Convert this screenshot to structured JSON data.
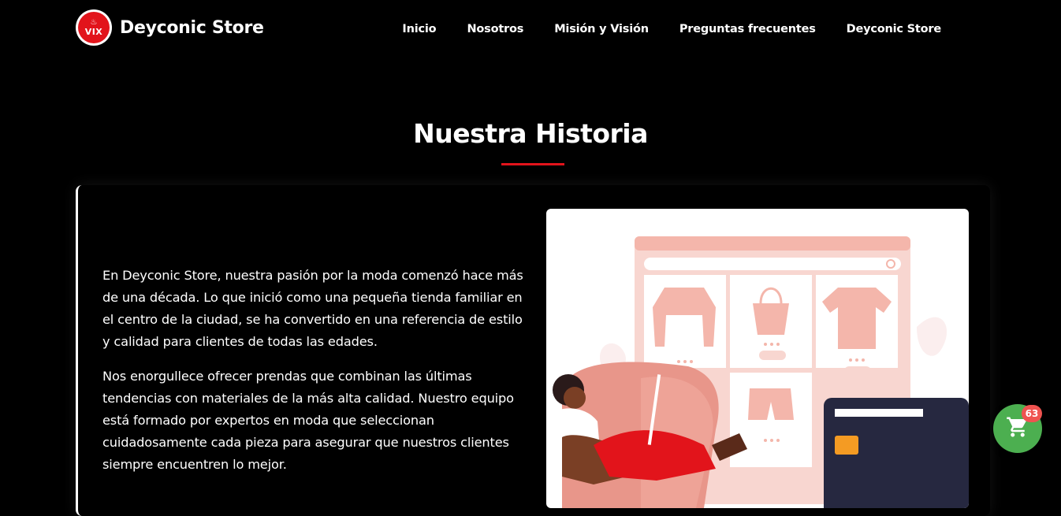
{
  "brand": {
    "name": "Deyconic Store",
    "logo_text": "VIX"
  },
  "nav": {
    "items": [
      {
        "label": "Inicio"
      },
      {
        "label": "Nosotros"
      },
      {
        "label": "Misión y Visión"
      },
      {
        "label": "Preguntas frecuentes"
      },
      {
        "label": "Deyconic Store"
      }
    ]
  },
  "history": {
    "title": "Nuestra Historia",
    "paragraphs": [
      "En Deyconic Store, nuestra pasión por la moda comenzó hace más de una década. Lo que inició como una pequeña tienda familiar en el centro de la ciudad, se ha convertido en una referencia de estilo y calidad para clientes de todas las edades.",
      "Nos enorgullece ofrecer prendas que combinan las últimas tendencias con materiales de la más alta calidad. Nuestro equipo está formado por expertos en moda que seleccionan cuidadosamente cada pieza para asegurar que nuestros clientes siempre encuentren lo mejor."
    ]
  },
  "cart": {
    "count": "63",
    "icon": "shopping-cart-icon"
  },
  "colors": {
    "background": "#000000",
    "accent": "#e2141b",
    "cart_button": "#4caf50",
    "badge": "#ef5350",
    "illustration_pink": "#f4b6ab",
    "illustration_red": "#e2141b",
    "card_dark": "#262840",
    "card_chip": "#f49b23"
  }
}
